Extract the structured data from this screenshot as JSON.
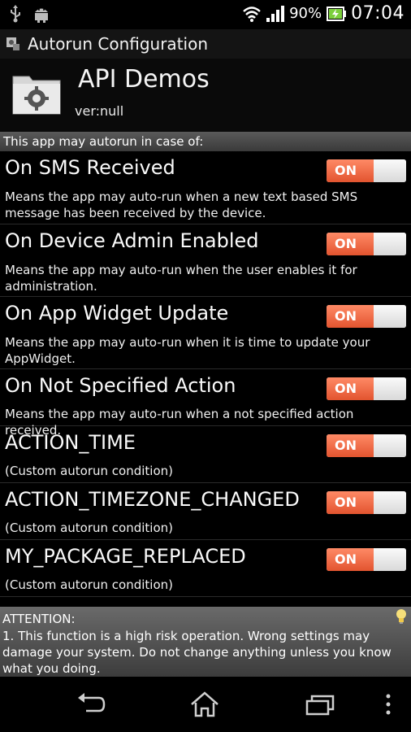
{
  "status_bar": {
    "battery_percent": "90%",
    "time": "07:04"
  },
  "titlebar": {
    "title": "Autorun Configuration"
  },
  "app": {
    "name": "API Demos",
    "version": "ver:null"
  },
  "section_header": "This app may autorun in case of:",
  "items": [
    {
      "title": "On SMS Received",
      "desc": "Means the app may auto-run when a new text based SMS message has been received by the device.",
      "toggle": "ON"
    },
    {
      "title": "On Device Admin Enabled",
      "desc": "Means the app may auto-run when the user enables it for administration.",
      "toggle": "ON"
    },
    {
      "title": "On App Widget Update",
      "desc": "Means the app may auto-run when it is time to update your AppWidget.",
      "toggle": "ON"
    },
    {
      "title": "On Not Specified Action",
      "desc": "Means the app may auto-run when a not specified action received.",
      "toggle": "ON"
    },
    {
      "title": "ACTION_TIME",
      "desc": "(Custom autorun condition)",
      "toggle": "ON"
    },
    {
      "title": "ACTION_TIMEZONE_CHANGED",
      "desc": "(Custom autorun condition)",
      "toggle": "ON"
    },
    {
      "title": "MY_PACKAGE_REPLACED",
      "desc": "(Custom autorun condition)",
      "toggle": "ON"
    }
  ],
  "attention": {
    "title": "ATTENTION:",
    "text": "1. This function is a high risk operation. Wrong settings may damage your system. Do not change anything unless you know what you doing."
  },
  "colors": {
    "toggle_on": "#e9613a",
    "toggle_off": "#d9d9d9"
  }
}
